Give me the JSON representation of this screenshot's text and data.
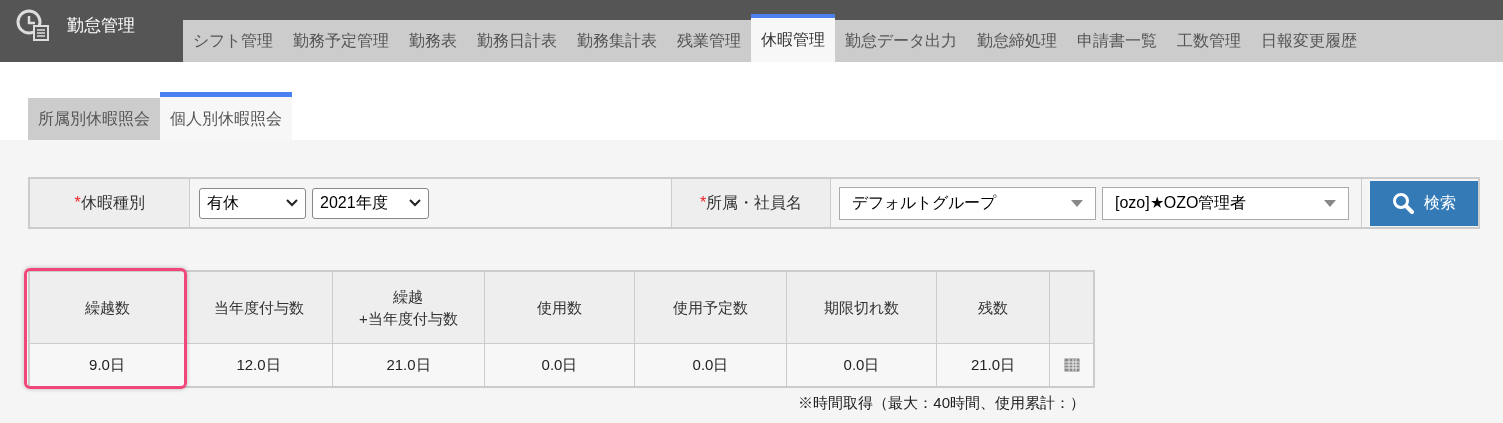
{
  "app": {
    "title": "勤怠管理"
  },
  "nav_tabs": [
    {
      "label": "シフト管理",
      "selected": false
    },
    {
      "label": "勤務予定管理",
      "selected": false
    },
    {
      "label": "勤務表",
      "selected": false
    },
    {
      "label": "勤務日計表",
      "selected": false
    },
    {
      "label": "勤務集計表",
      "selected": false
    },
    {
      "label": "残業管理",
      "selected": false
    },
    {
      "label": "休暇管理",
      "selected": true
    },
    {
      "label": "勤怠データ出力",
      "selected": false
    },
    {
      "label": "勤怠締処理",
      "selected": false
    },
    {
      "label": "申請書一覧",
      "selected": false
    },
    {
      "label": "工数管理",
      "selected": false
    },
    {
      "label": "日報変更履歴",
      "selected": false
    }
  ],
  "sub_tabs": [
    {
      "label": "所属別休暇照会",
      "selected": false
    },
    {
      "label": "個人別休暇照会",
      "selected": true
    }
  ],
  "search_form": {
    "required_mark": "*",
    "leave_type_label": "休暇種別",
    "leave_type": "有休",
    "fiscal_year": "2021年度",
    "employee_label": "所属・社員名",
    "group": "デフォルトグループ",
    "employee": "[ozo]★OZO管理者",
    "search_button": "検索"
  },
  "table": {
    "columns": [
      {
        "label": "繰越数",
        "highlighted": true
      },
      {
        "label": "当年度付与数",
        "highlighted": false
      },
      {
        "label": "繰越\n+当年度付与数",
        "highlighted": false
      },
      {
        "label": "使用数",
        "highlighted": false
      },
      {
        "label": "使用予定数",
        "highlighted": false
      },
      {
        "label": "期限切れ数",
        "highlighted": false
      },
      {
        "label": "残数",
        "highlighted": false
      }
    ],
    "row": [
      "9.0日",
      "12.0日",
      "21.0日",
      "0.0日",
      "0.0日",
      "0.0日",
      "21.0日"
    ]
  },
  "note": "※時間取得（最大：40時間、使用累計：）"
}
